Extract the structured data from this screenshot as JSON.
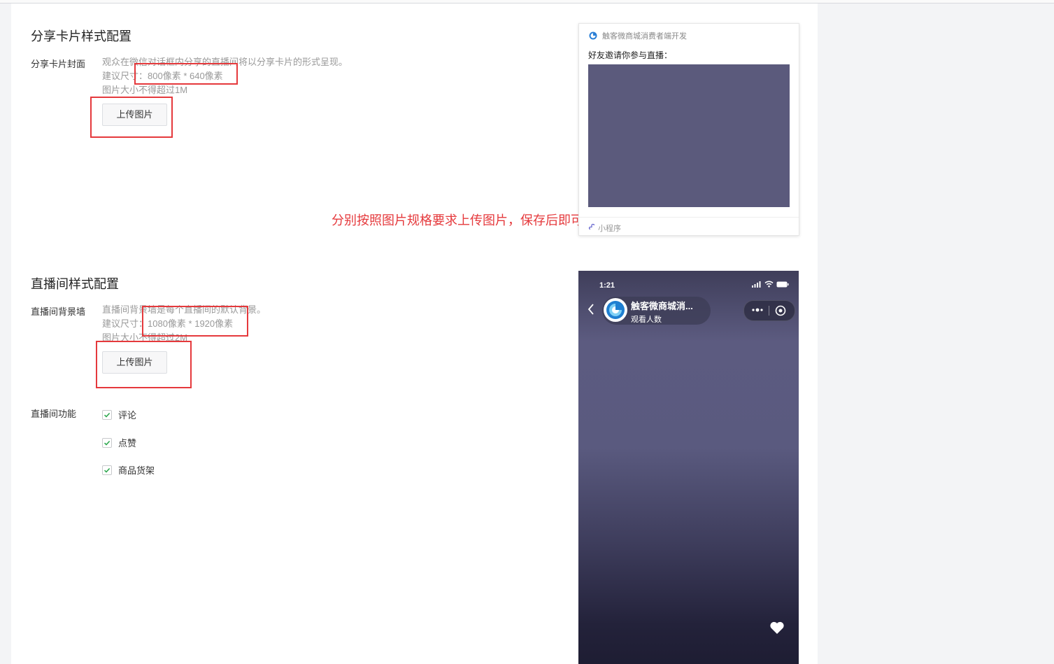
{
  "share_section": {
    "title": "分享卡片样式配置",
    "cover_label": "分享卡片封面",
    "hint_line1": "观众在微信对话框内分享的直播间将以分享卡片的形式呈现。",
    "hint_line2_prefix": "建议尺寸：",
    "hint_line2_size": "800像素 * 640像素",
    "hint_line3": "图片大小不得超过1M",
    "upload_label": "上传图片"
  },
  "annotation": {
    "note": "分别按照图片规格要求上传图片，保存后即可",
    "color": "#e5393c"
  },
  "live_section": {
    "title": "直播间样式配置",
    "bg_label": "直播间背景墙",
    "hint_line1": "直播间背景墙是每个直播间的默认背景。",
    "hint_line2_prefix": "建议尺寸：",
    "hint_line2_size": "1080像素 * 1920像素",
    "hint_line3": "图片大小不得超过2M",
    "upload_label": "上传图片",
    "features_label": "直播间功能",
    "features": [
      {
        "label": "评论",
        "checked": true
      },
      {
        "label": "点赞",
        "checked": true
      },
      {
        "label": "商品货架",
        "checked": true
      }
    ]
  },
  "share_card_preview": {
    "app_name": "触客微商城消费者端开发",
    "invite_text": "好友邀请你参与直播：",
    "footer_label": "小程序",
    "image_color": "#5b5a7c"
  },
  "live_preview": {
    "time": "1:21",
    "host_name": "触客微商城消...",
    "host_sub": "观看人数"
  }
}
